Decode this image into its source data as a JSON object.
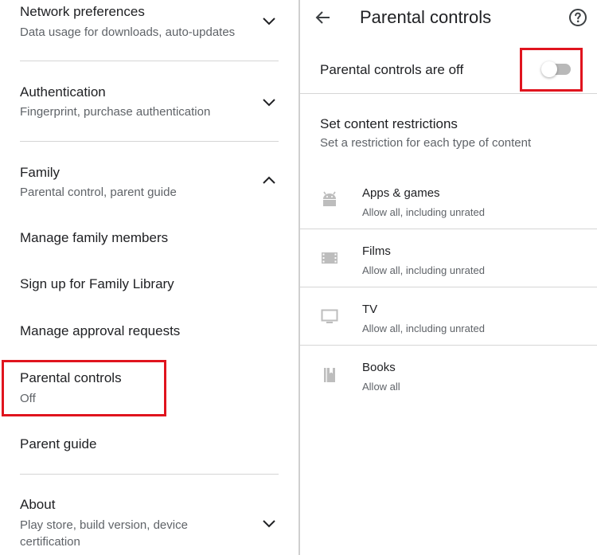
{
  "left": {
    "network": {
      "title": "Network preferences",
      "subtitle": "Data usage for downloads, auto-updates"
    },
    "authentication": {
      "title": "Authentication",
      "subtitle": "Fingerprint, purchase authentication"
    },
    "family": {
      "title": "Family",
      "subtitle": "Parental control, parent guide",
      "items": {
        "manage_members": "Manage family members",
        "sign_up_library": "Sign up for Family Library",
        "approval_requests": "Manage approval requests",
        "parental_controls": {
          "title": "Parental controls",
          "status": "Off"
        },
        "parent_guide": "Parent guide"
      }
    },
    "about": {
      "title": "About",
      "subtitle_line1": "Play store, build version, device",
      "subtitle_line2": "certification"
    }
  },
  "right": {
    "header": {
      "title": "Parental controls"
    },
    "toggle_row": {
      "label": "Parental controls are off",
      "enabled": false
    },
    "restrictions": {
      "title": "Set content restrictions",
      "subtitle": "Set a restriction for each type of content",
      "categories": [
        {
          "label": "Apps & games",
          "value": "Allow all, including unrated",
          "icon": "android-icon"
        },
        {
          "label": "Films",
          "value": "Allow all, including unrated",
          "icon": "film-icon"
        },
        {
          "label": "TV",
          "value": "Allow all, including unrated",
          "icon": "tv-icon"
        },
        {
          "label": "Books",
          "value": "Allow all",
          "icon": "book-icon"
        }
      ]
    }
  },
  "colors": {
    "highlight": "#e0141e",
    "text_primary": "#202124",
    "text_secondary": "#5f6368",
    "icon_gray": "#bdbdbd",
    "toggle_off_track": "#b9b9b9"
  }
}
